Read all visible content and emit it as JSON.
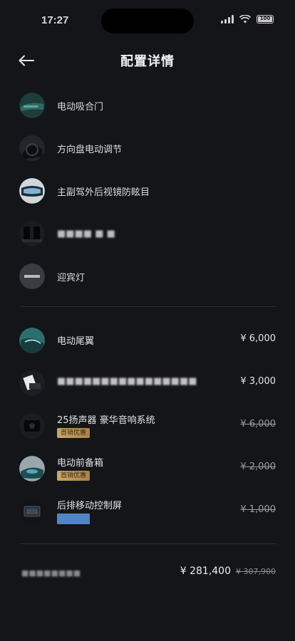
{
  "status_bar": {
    "time": "17:27",
    "battery": "100"
  },
  "header": {
    "title": "配置详情"
  },
  "standard_items": [
    {
      "label": "电动吸合门",
      "thumb": "door-thumb"
    },
    {
      "label": "方向盘电动调节",
      "thumb": "steering-thumb"
    },
    {
      "label": "主副驾外后视镜防眩目",
      "thumb": "mirror-thumb"
    },
    {
      "label": "■■■■ ■ ■",
      "thumb": "seat-thumb",
      "blurred": true
    },
    {
      "label": "迎宾灯",
      "thumb": "welcome-light-thumb"
    }
  ],
  "option_items": [
    {
      "label": "电动尾翼",
      "price": "¥ 6,000",
      "struck": false,
      "tag": null,
      "thumb": "spoiler-thumb"
    },
    {
      "label": "■■■■■■■■■■■■■■■■",
      "price": "¥ 3,000",
      "struck": false,
      "tag": null,
      "blurred": true,
      "thumb": "console-thumb"
    },
    {
      "label": "25扬声器 豪华音响系统",
      "price": "¥ 6,000",
      "struck": true,
      "tag": "首销优惠",
      "thumb": "speaker-thumb"
    },
    {
      "label": "电动前备箱",
      "price": "¥ 2,000",
      "struck": true,
      "tag": "首销优惠",
      "thumb": "frunk-thumb"
    },
    {
      "label": "后排移动控制屏",
      "price": "¥ 1,000",
      "struck": true,
      "tag": "blue",
      "thumb": "rear-screen-thumb"
    }
  ],
  "total": {
    "label": "■■■■■■■■",
    "price": "¥ 281,400",
    "original": "¥ 307,900"
  },
  "colors": {
    "background": "#141519",
    "promo_tag": "#c9a56a",
    "blue_tag": "#4f86c6"
  }
}
